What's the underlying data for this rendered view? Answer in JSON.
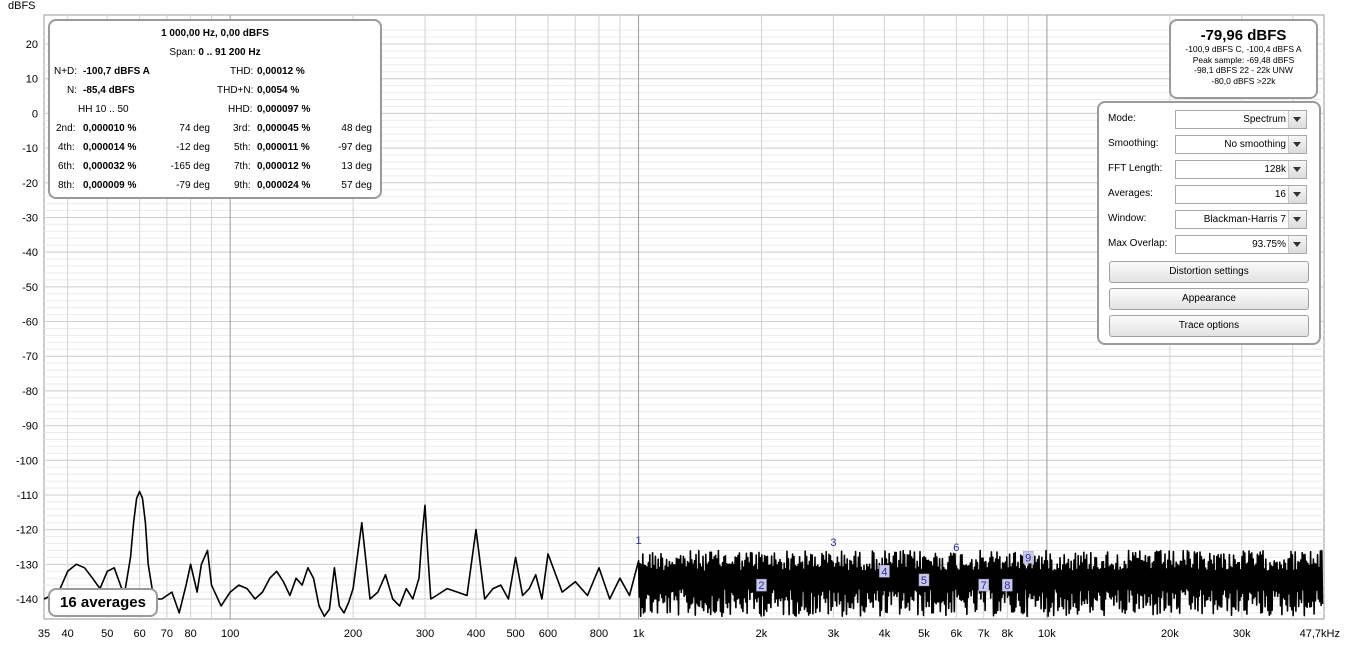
{
  "chart_data": {
    "type": "line",
    "ylabel": "dBFS",
    "xscale": "log",
    "xlim": [
      35,
      47700
    ],
    "ylim": [
      -145,
      25
    ],
    "y_ticks": [
      20,
      10,
      0,
      -10,
      -20,
      -30,
      -40,
      -50,
      -60,
      -70,
      -80,
      -90,
      -100,
      -110,
      -120,
      -130,
      -140
    ],
    "x_ticks": [
      {
        "v": 35,
        "t": "35"
      },
      {
        "v": 40,
        "t": "40"
      },
      {
        "v": 50,
        "t": "50"
      },
      {
        "v": 60,
        "t": "60"
      },
      {
        "v": 70,
        "t": "70"
      },
      {
        "v": 80,
        "t": "80"
      },
      {
        "v": 100,
        "t": "100"
      },
      {
        "v": 200,
        "t": "200"
      },
      {
        "v": 300,
        "t": "300"
      },
      {
        "v": 400,
        "t": "400"
      },
      {
        "v": 500,
        "t": "500"
      },
      {
        "v": 600,
        "t": "600"
      },
      {
        "v": 800,
        "t": "800"
      },
      {
        "v": 1000,
        "t": "1k"
      },
      {
        "v": 2000,
        "t": "2k"
      },
      {
        "v": 3000,
        "t": "3k"
      },
      {
        "v": 4000,
        "t": "4k"
      },
      {
        "v": 5000,
        "t": "5k"
      },
      {
        "v": 6000,
        "t": "6k"
      },
      {
        "v": 7000,
        "t": "7k"
      },
      {
        "v": 8000,
        "t": "8k"
      },
      {
        "v": 10000,
        "t": "10k"
      },
      {
        "v": 20000,
        "t": "20k"
      },
      {
        "v": 30000,
        "t": "30k"
      },
      {
        "v": 47700,
        "t": "47,7kHz"
      }
    ],
    "trace_color": "#000000",
    "grid": true,
    "series": [
      {
        "x": [
          35,
          38,
          40,
          42,
          44,
          46,
          48,
          50,
          52,
          55,
          57,
          58,
          59,
          60,
          61,
          62,
          63,
          65,
          68,
          70,
          72,
          75,
          78,
          80,
          83,
          85,
          88,
          90,
          95,
          100,
          105,
          110,
          115,
          120,
          125,
          130,
          135,
          140,
          145,
          150,
          155,
          160,
          165,
          170,
          175,
          180,
          185,
          190,
          195,
          200,
          210,
          220,
          230,
          240,
          250,
          260,
          270,
          280,
          290,
          295,
          300,
          305,
          310,
          320,
          340,
          360,
          380,
          400,
          420,
          440,
          460,
          480,
          500,
          520,
          540,
          560,
          580,
          600,
          650,
          700,
          750,
          800,
          850,
          900,
          950,
          1000
        ],
        "y": [
          -140,
          -138,
          -132,
          -130,
          -131,
          -134,
          -137,
          -132,
          -131,
          -139,
          -128,
          -118,
          -111,
          -109,
          -111,
          -118,
          -130,
          -140,
          -140,
          -139,
          -138,
          -144,
          -136,
          -130,
          -138,
          -130,
          -126,
          -136,
          -142,
          -138,
          -136,
          -137,
          -140,
          -138,
          -134,
          -132,
          -135,
          -139,
          -134,
          -136,
          -131,
          -134,
          -142,
          -145,
          -143,
          -131,
          -142,
          -144,
          -141,
          -137,
          -118,
          -140,
          -138,
          -133,
          -140,
          -142,
          -137,
          -140,
          -134,
          -122,
          -113,
          -128,
          -140,
          -139,
          -137,
          -138,
          -139,
          -120,
          -140,
          -137,
          -136,
          -140,
          -128,
          -139,
          -137,
          -133,
          -140,
          -127,
          -138,
          -135,
          -139,
          -131,
          -140,
          -134,
          -139,
          -129
        ]
      }
    ],
    "harmonic_markers": [
      "1",
      "2",
      "3",
      "4",
      "5",
      "6",
      "7",
      "8",
      "9"
    ]
  },
  "y_unit": "dBFS",
  "distortion": {
    "header1": "1 000,00 Hz, 0,00 dBFS",
    "header2_label": "Span:",
    "header2_value": "0 .. 91 200 Hz",
    "nd_label": "N+D:",
    "nd_value": "-100,7 dBFS A",
    "thd_label": "THD:",
    "thd_value": "0,00012 %",
    "n_label": "N:",
    "n_value": "-85,4 dBFS",
    "thdn_label": "THD+N:",
    "thdn_value": "0,0054 %",
    "hh_label": "HH 10 .. 50",
    "hhd_label": "HHD:",
    "hhd_value": "0,000097 %",
    "harmonics": [
      {
        "label": "2nd:",
        "value": "0,000010 %",
        "phase": "74 deg",
        "label2": "3rd:",
        "value2": "0,000045 %",
        "phase2": "48 deg"
      },
      {
        "label": "4th:",
        "value": "0,000014 %",
        "phase": "-12 deg",
        "label2": "5th:",
        "value2": "0,000011 %",
        "phase2": "-97 deg"
      },
      {
        "label": "6th:",
        "value": "0,000032 %",
        "phase": "-165 deg",
        "label2": "7th:",
        "value2": "0,000012 %",
        "phase2": "13 deg"
      },
      {
        "label": "8th:",
        "value": "0,000009 %",
        "phase": "-79 deg",
        "label2": "9th:",
        "value2": "0,000024 %",
        "phase2": "57 deg"
      }
    ]
  },
  "level": {
    "main": "-79,96 dBFS",
    "line1": "-100,9 dBFS C, -100,4 dBFS A",
    "line2": "Peak sample: -69,48 dBFS",
    "line3": "-98,1 dBFS 22 - 22k UNW",
    "line4": "-80,0 dBFS >22k"
  },
  "settings": {
    "rows": [
      {
        "label": "Mode:",
        "value": "Spectrum"
      },
      {
        "label": "Smoothing:",
        "value": "No  smoothing"
      },
      {
        "label": "FFT Length:",
        "value": "128k"
      },
      {
        "label": "Averages:",
        "value": "16"
      },
      {
        "label": "Window:",
        "value": "Blackman-Harris 7"
      },
      {
        "label": "Max Overlap:",
        "value": "93.75%"
      }
    ],
    "buttons": [
      "Distortion settings",
      "Appearance",
      "Trace options"
    ]
  },
  "averages_label": "16 averages"
}
